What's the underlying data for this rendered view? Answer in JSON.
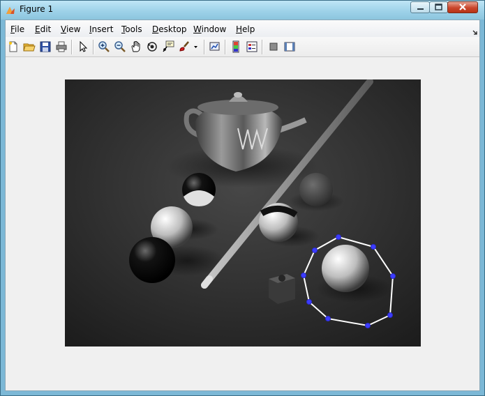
{
  "window": {
    "title": "Figure 1"
  },
  "menu": {
    "file": {
      "u": "F",
      "rest": "ile"
    },
    "edit": {
      "u": "E",
      "rest": "dit"
    },
    "view": {
      "u": "V",
      "rest": "iew"
    },
    "insert": {
      "u": "I",
      "rest": "nsert"
    },
    "tools": {
      "u": "T",
      "rest": "ools"
    },
    "desktop": {
      "u": "D",
      "rest": "esktop"
    },
    "window": {
      "u": "W",
      "rest": "indow"
    },
    "help": {
      "u": "H",
      "rest": "elp"
    }
  },
  "toolbar": {
    "icons": [
      "new-figure-icon",
      "open-file-icon",
      "save-icon",
      "print-icon",
      "edit-plot-icon",
      "zoom-in-icon",
      "zoom-out-icon",
      "pan-icon",
      "rotate-3d-icon",
      "data-cursor-icon",
      "brush-icon",
      "brush-dropdown-icon",
      "link-plot-icon",
      "insert-colorbar-icon",
      "insert-legend-icon",
      "hide-plot-tools-icon",
      "show-plot-tools-icon"
    ]
  },
  "colors": {
    "roi": "#ffffff",
    "vertex": "#3d3dff",
    "background": "#2b2b2b"
  }
}
